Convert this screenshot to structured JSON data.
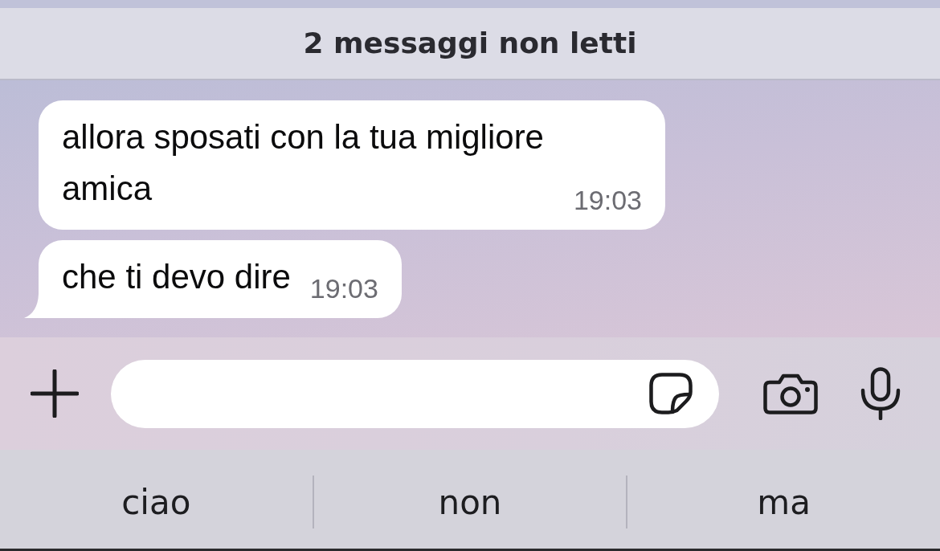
{
  "unread_banner": {
    "text": "2 messaggi non letti"
  },
  "messages": [
    {
      "text": "allora sposati con la tua migliore amica",
      "time": "19:03",
      "tail": false
    },
    {
      "text": "che ti devo dire",
      "time": "19:03",
      "tail": true
    }
  ],
  "suggestions": [
    "ciao",
    "non",
    "ma"
  ]
}
